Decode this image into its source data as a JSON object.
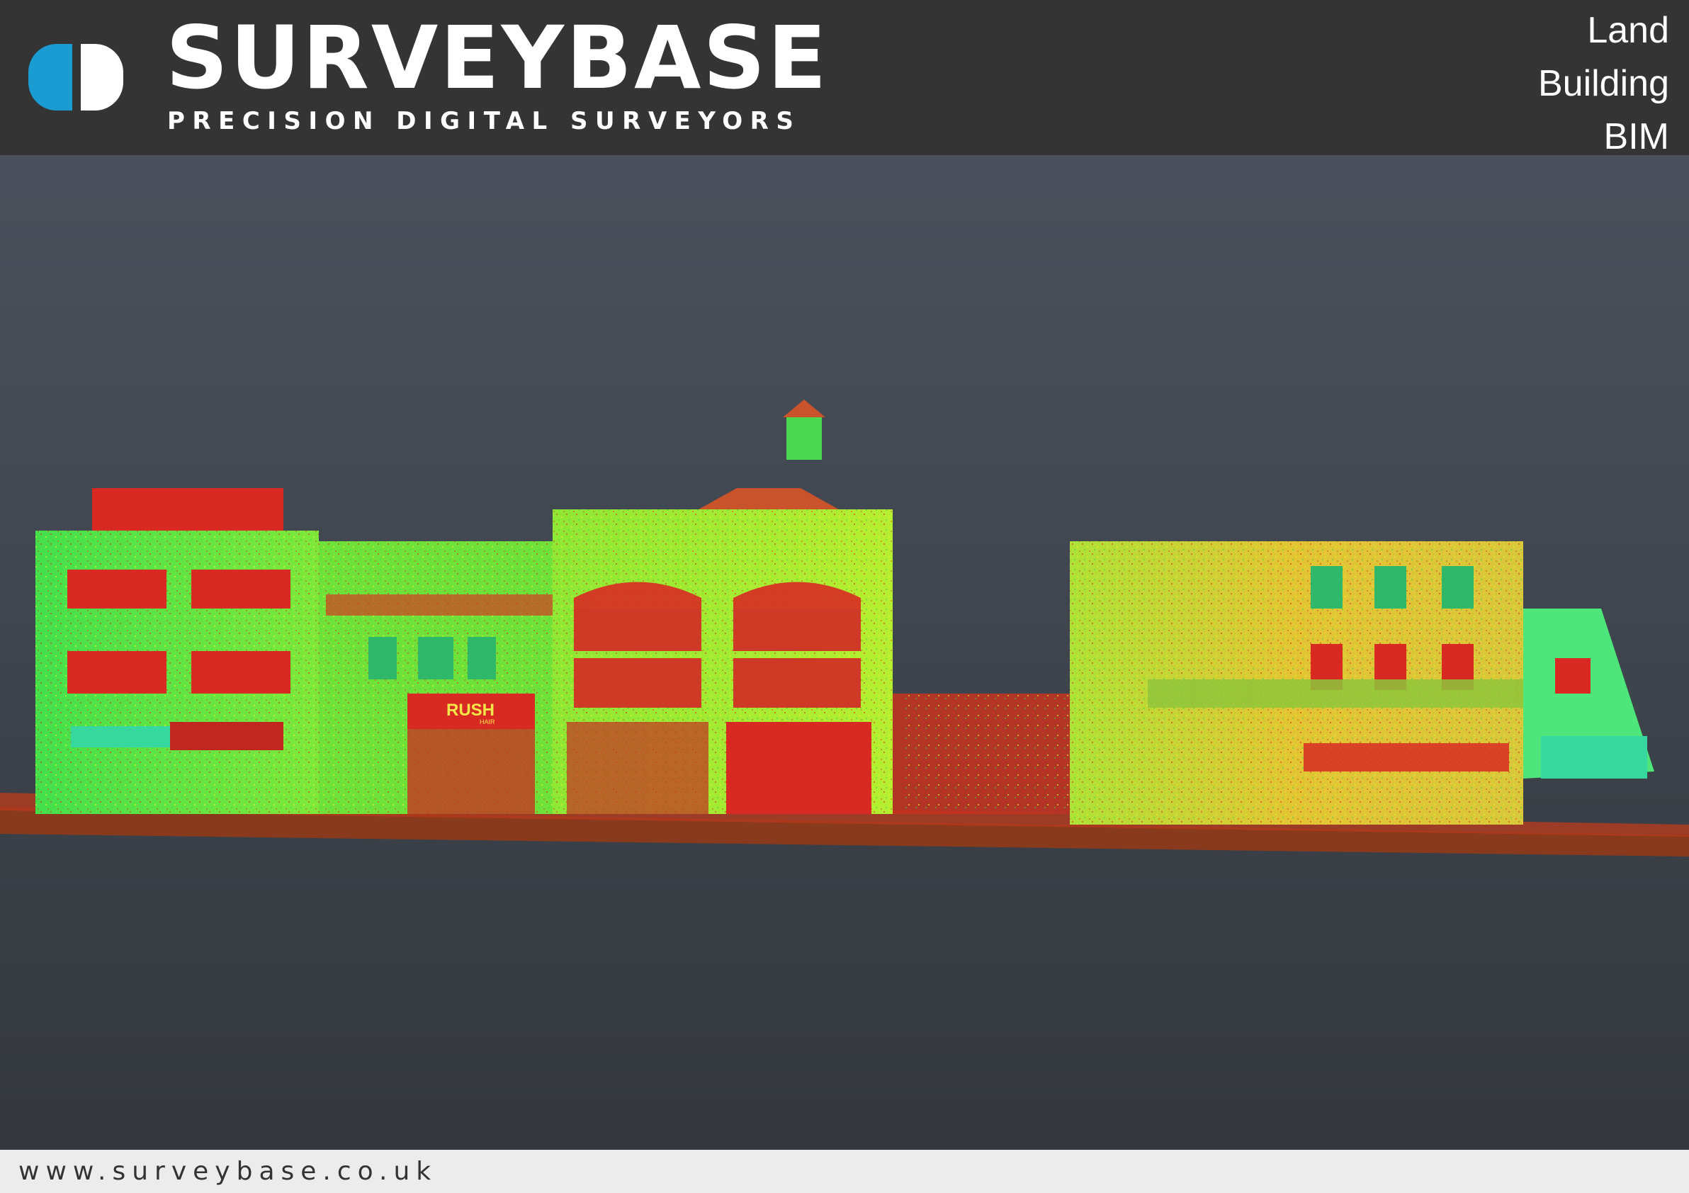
{
  "brand": {
    "name": "SURVEYBASE",
    "tagline": "PRECISION DIGITAL SURVEYORS",
    "logo_colors": {
      "left": "#1a9bd1",
      "right": "#ffffff"
    }
  },
  "services": [
    "Land",
    "Building",
    "BIM"
  ],
  "scan": {
    "shop_sign": "RUSH",
    "shop_sign_sub": "HAIR",
    "palette": [
      "#2fd64a",
      "#9cf02a",
      "#e8ef2c",
      "#e2b52e",
      "#d82a22",
      "#8a3a1c"
    ]
  },
  "footer": {
    "website": "www.surveybase.co.uk"
  },
  "colors": {
    "header_bg": "#343434",
    "footer_bg": "#ececec",
    "viewport_top": "#4a515c",
    "viewport_bottom": "#33373d"
  }
}
